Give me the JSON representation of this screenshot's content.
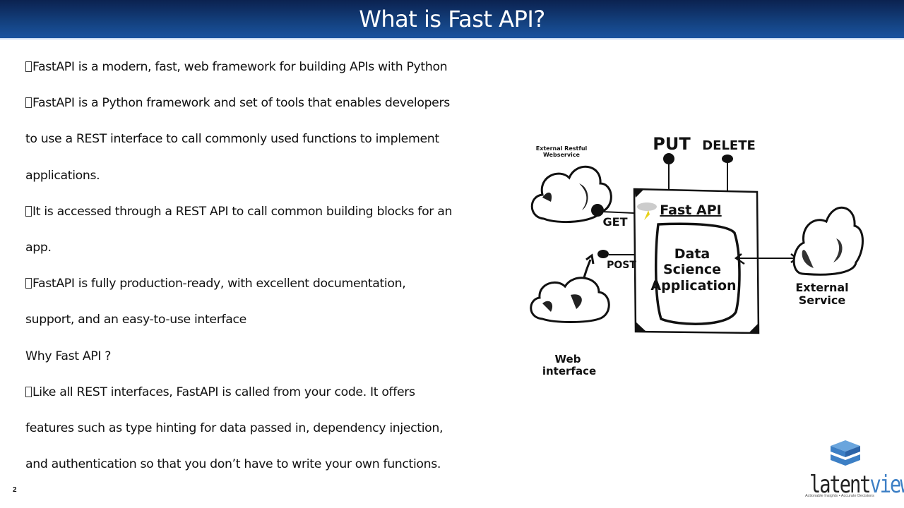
{
  "slide": {
    "title": "What is Fast API?",
    "page_number": "2",
    "colors": {
      "title_bar_top": "#0b2250",
      "title_bar_bottom": "#1a54a0",
      "title_text": "#ffffff",
      "body_text": "#111111",
      "logo_accent": "#3c7fc5"
    }
  },
  "body": {
    "lines": [
      {
        "bullet": true,
        "text": "FastAPI is a modern, fast, web framework for building APIs with Python"
      },
      {
        "bullet": true,
        "text": "FastAPI is a Python framework and set of tools that enables developers"
      },
      {
        "bullet": false,
        "text": "to use a REST interface to call commonly used functions to implement"
      },
      {
        "bullet": false,
        "text": "applications."
      },
      {
        "bullet": true,
        "text": "It is accessed through a REST API to call common building blocks for an"
      },
      {
        "bullet": false,
        "text": "app."
      },
      {
        "bullet": true,
        "text": "FastAPI is fully production-ready, with excellent documentation,"
      },
      {
        "bullet": false,
        "text": "support, and an easy-to-use interface"
      },
      {
        "bullet": false,
        "text": "Why Fast API ?"
      },
      {
        "bullet": true,
        "text": "Like all REST interfaces, FastAPI is called from your code. It offers"
      },
      {
        "bullet": false,
        "text": "features such as type hinting for data passed in, dependency injection,"
      },
      {
        "bullet": false,
        "text": "and authentication so that you don’t have to write your own functions."
      }
    ]
  },
  "diagram": {
    "external_restful": "External Restful",
    "webservice": "Webservice",
    "put": "PUT",
    "delete": "DELETE",
    "get": "GET",
    "post": "POST",
    "fast_api": "Fast API",
    "data": "Data",
    "science": "Science",
    "application": "Application",
    "external": "External",
    "service": "Service",
    "web": "Web",
    "interface": "interface",
    "icons": [
      "cloud-icon",
      "lightning-cloud-icon"
    ]
  },
  "logo": {
    "word_dark": "latent",
    "word_accent": "view",
    "tagline": "Actionable Insights • Accurate Decisions"
  }
}
